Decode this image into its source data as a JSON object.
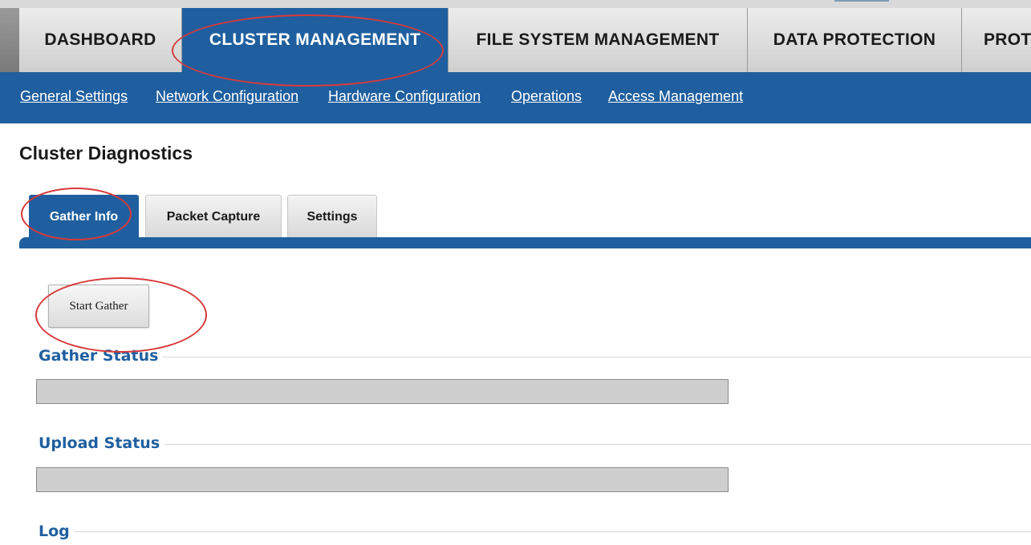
{
  "main_nav": {
    "tabs": [
      {
        "label": "DASHBOARD",
        "active": false
      },
      {
        "label": "CLUSTER MANAGEMENT",
        "active": true
      },
      {
        "label": "FILE SYSTEM MANAGEMENT",
        "active": false
      },
      {
        "label": "DATA PROTECTION",
        "active": false
      },
      {
        "label": "PROT",
        "active": false
      }
    ]
  },
  "sub_nav": {
    "links": [
      {
        "label": "General Settings"
      },
      {
        "label": "Network Configuration"
      },
      {
        "label": "Hardware Configuration"
      },
      {
        "label": "Operations"
      },
      {
        "label": "Access Management"
      }
    ]
  },
  "page": {
    "title": "Cluster Diagnostics",
    "tabs": [
      {
        "label": "Gather Info",
        "active": true
      },
      {
        "label": "Packet Capture",
        "active": false
      },
      {
        "label": "Settings",
        "active": false
      }
    ],
    "start_button_label": "Start Gather",
    "gather_status": {
      "label": "Gather Status",
      "progress": 0
    },
    "upload_status": {
      "label": "Upload Status",
      "progress": 0
    },
    "log": {
      "label": "Log"
    }
  },
  "colors": {
    "accent": "#1f5f9f",
    "annotation": "#d83a3a"
  }
}
